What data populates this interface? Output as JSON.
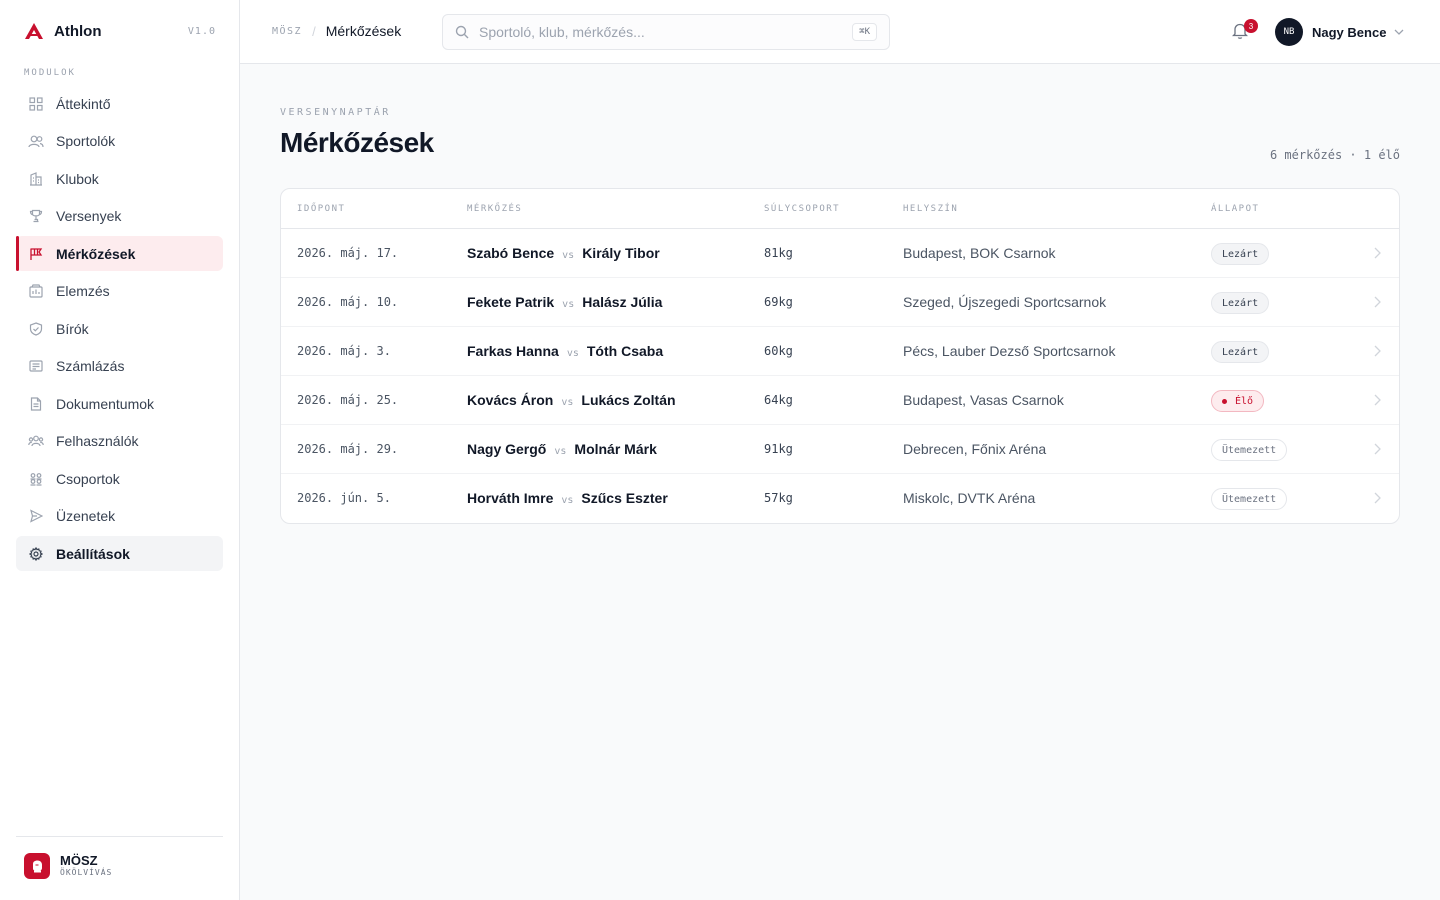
{
  "brand": {
    "name": "Athlon",
    "version": "V1.0"
  },
  "sidebar": {
    "section_label": "MODULOK",
    "items": [
      {
        "label": "Áttekintő",
        "icon": "grid-icon"
      },
      {
        "label": "Sportolók",
        "icon": "users-icon"
      },
      {
        "label": "Klubok",
        "icon": "building-icon"
      },
      {
        "label": "Versenyek",
        "icon": "trophy-icon"
      },
      {
        "label": "Mérkőzések",
        "icon": "flag-icon"
      },
      {
        "label": "Elemzés",
        "icon": "chart-icon"
      },
      {
        "label": "Bírók",
        "icon": "shield-icon"
      },
      {
        "label": "Számlázás",
        "icon": "receipt-icon"
      },
      {
        "label": "Dokumentumok",
        "icon": "document-icon"
      },
      {
        "label": "Felhasználók",
        "icon": "user-group-icon"
      },
      {
        "label": "Csoportok",
        "icon": "groups-icon"
      },
      {
        "label": "Üzenetek",
        "icon": "send-icon"
      },
      {
        "label": "Beállítások",
        "icon": "gear-icon"
      }
    ],
    "active_item": "Mérkőzések",
    "hover_item": "Beállítások",
    "footer": {
      "org_name": "MÖSZ",
      "org_sub": "ÖKÖLVÍVÁS"
    }
  },
  "topbar": {
    "breadcrumb_root": "MÖSZ",
    "breadcrumb_sep": "/",
    "breadcrumb_current": "Mérkőzések",
    "search_placeholder": "Sportoló, klub, mérkőzés...",
    "search_shortcut": "⌘K",
    "notification_count": "3",
    "user": {
      "initials": "NB",
      "name": "Nagy Bence"
    }
  },
  "main": {
    "eyebrow": "VERSENYNAPTÁR",
    "title": "Mérkőzések",
    "meta": "6 mérkőzés · 1 élő",
    "columns": [
      "IDŐPONT",
      "MÉRKŐZÉS",
      "SÚLYCSOPORT",
      "HELYSZÍN",
      "ÁLLAPOT"
    ],
    "vs_label": "vs",
    "rows": [
      {
        "date": "2026. máj. 17.",
        "a": "Szabó Bence",
        "b": "Király Tibor",
        "weight": "81kg",
        "venue": "Budapest, BOK Csarnok",
        "status": "Lezárt",
        "status_kind": "closed"
      },
      {
        "date": "2026. máj. 10.",
        "a": "Fekete Patrik",
        "b": "Halász Júlia",
        "weight": "69kg",
        "venue": "Szeged, Újszegedi Sportcsarnok",
        "status": "Lezárt",
        "status_kind": "closed"
      },
      {
        "date": "2026. máj. 3.",
        "a": "Farkas Hanna",
        "b": "Tóth Csaba",
        "weight": "60kg",
        "venue": "Pécs, Lauber Dezső Sportcsarnok",
        "status": "Lezárt",
        "status_kind": "closed"
      },
      {
        "date": "2026. máj. 25.",
        "a": "Kovács Áron",
        "b": "Lukács Zoltán",
        "weight": "64kg",
        "venue": "Budapest, Vasas Csarnok",
        "status": "Élő",
        "status_kind": "live"
      },
      {
        "date": "2026. máj. 29.",
        "a": "Nagy Gergő",
        "b": "Molnár Márk",
        "weight": "91kg",
        "venue": "Debrecen, Főnix Aréna",
        "status": "Ütemezett",
        "status_kind": "sched"
      },
      {
        "date": "2026. jún. 5.",
        "a": "Horváth Imre",
        "b": "Szűcs Eszter",
        "weight": "57kg",
        "venue": "Miskolc, DVTK Aréna",
        "status": "Ütemezett",
        "status_kind": "sched"
      }
    ]
  },
  "colors": {
    "accent": "#c8102e",
    "text": "#111827",
    "muted": "#9ca3af",
    "border": "#e5e7eb"
  }
}
